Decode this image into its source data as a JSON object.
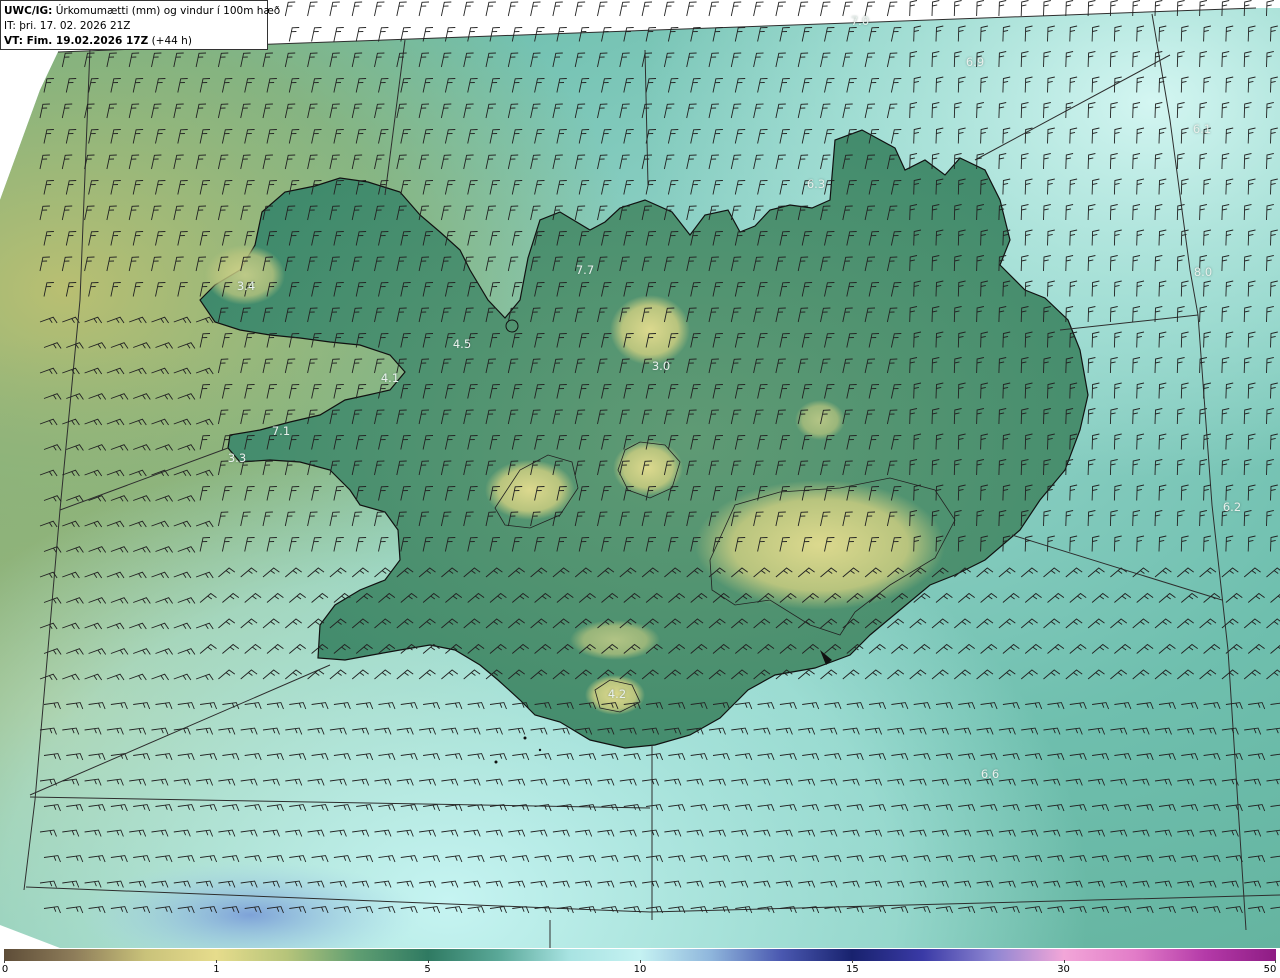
{
  "header": {
    "model": "UWC/IG:",
    "title": " Úrkomumætti (mm) og vindur í 100m hæð",
    "init_time": "IT: þri. 17. 02. 2026 21Z",
    "valid_prefix": "VT: Fim. 19.02.2026 17Z",
    "valid_suffix": " (+44 h)"
  },
  "colorbar": {
    "ticks": [
      {
        "label": "0",
        "value": 0
      },
      {
        "label": "1",
        "value": 1
      },
      {
        "label": "5",
        "value": 5
      },
      {
        "label": "10",
        "value": 10
      },
      {
        "label": "15",
        "value": 15
      },
      {
        "label": "30",
        "value": 30
      },
      {
        "label": "50",
        "value": 50
      }
    ],
    "colors": [
      "#5e4d38",
      "#8e7d5a",
      "#c9c27a",
      "#e6dc8c",
      "#b6c47a",
      "#5f9e72",
      "#2f7a62",
      "#5aa898",
      "#a8e3e2",
      "#c5f2f2",
      "#8fb6dc",
      "#4a58b0",
      "#18226e",
      "#3a3aa6",
      "#8e86d2",
      "#f2a6d8",
      "#e27cc8",
      "#b43aa8",
      "#8e1c84"
    ]
  },
  "value_labels": [
    {
      "text": "7.0"
    },
    {
      "text": "6.9"
    },
    {
      "text": "6.1"
    },
    {
      "text": "6.3"
    },
    {
      "text": "7.7"
    },
    {
      "text": "8.0"
    },
    {
      "text": "3.4"
    },
    {
      "text": "4.5"
    },
    {
      "text": "4.1"
    },
    {
      "text": "3.0"
    },
    {
      "text": "7.1"
    },
    {
      "text": "3.3"
    },
    {
      "text": "6.2"
    },
    {
      "text": "4.2"
    },
    {
      "text": "6.6"
    }
  ],
  "colors": {
    "sea_base": "#6fbfae",
    "sea_light": "#b8ece6",
    "land_green": "#3e8a6a",
    "highland_yellow": "#cfd48a",
    "sw_olive": "#a8b870",
    "south_blue": "#7aa6d8",
    "coast": "#111111",
    "grid": "#333333",
    "barb": "#222222"
  }
}
